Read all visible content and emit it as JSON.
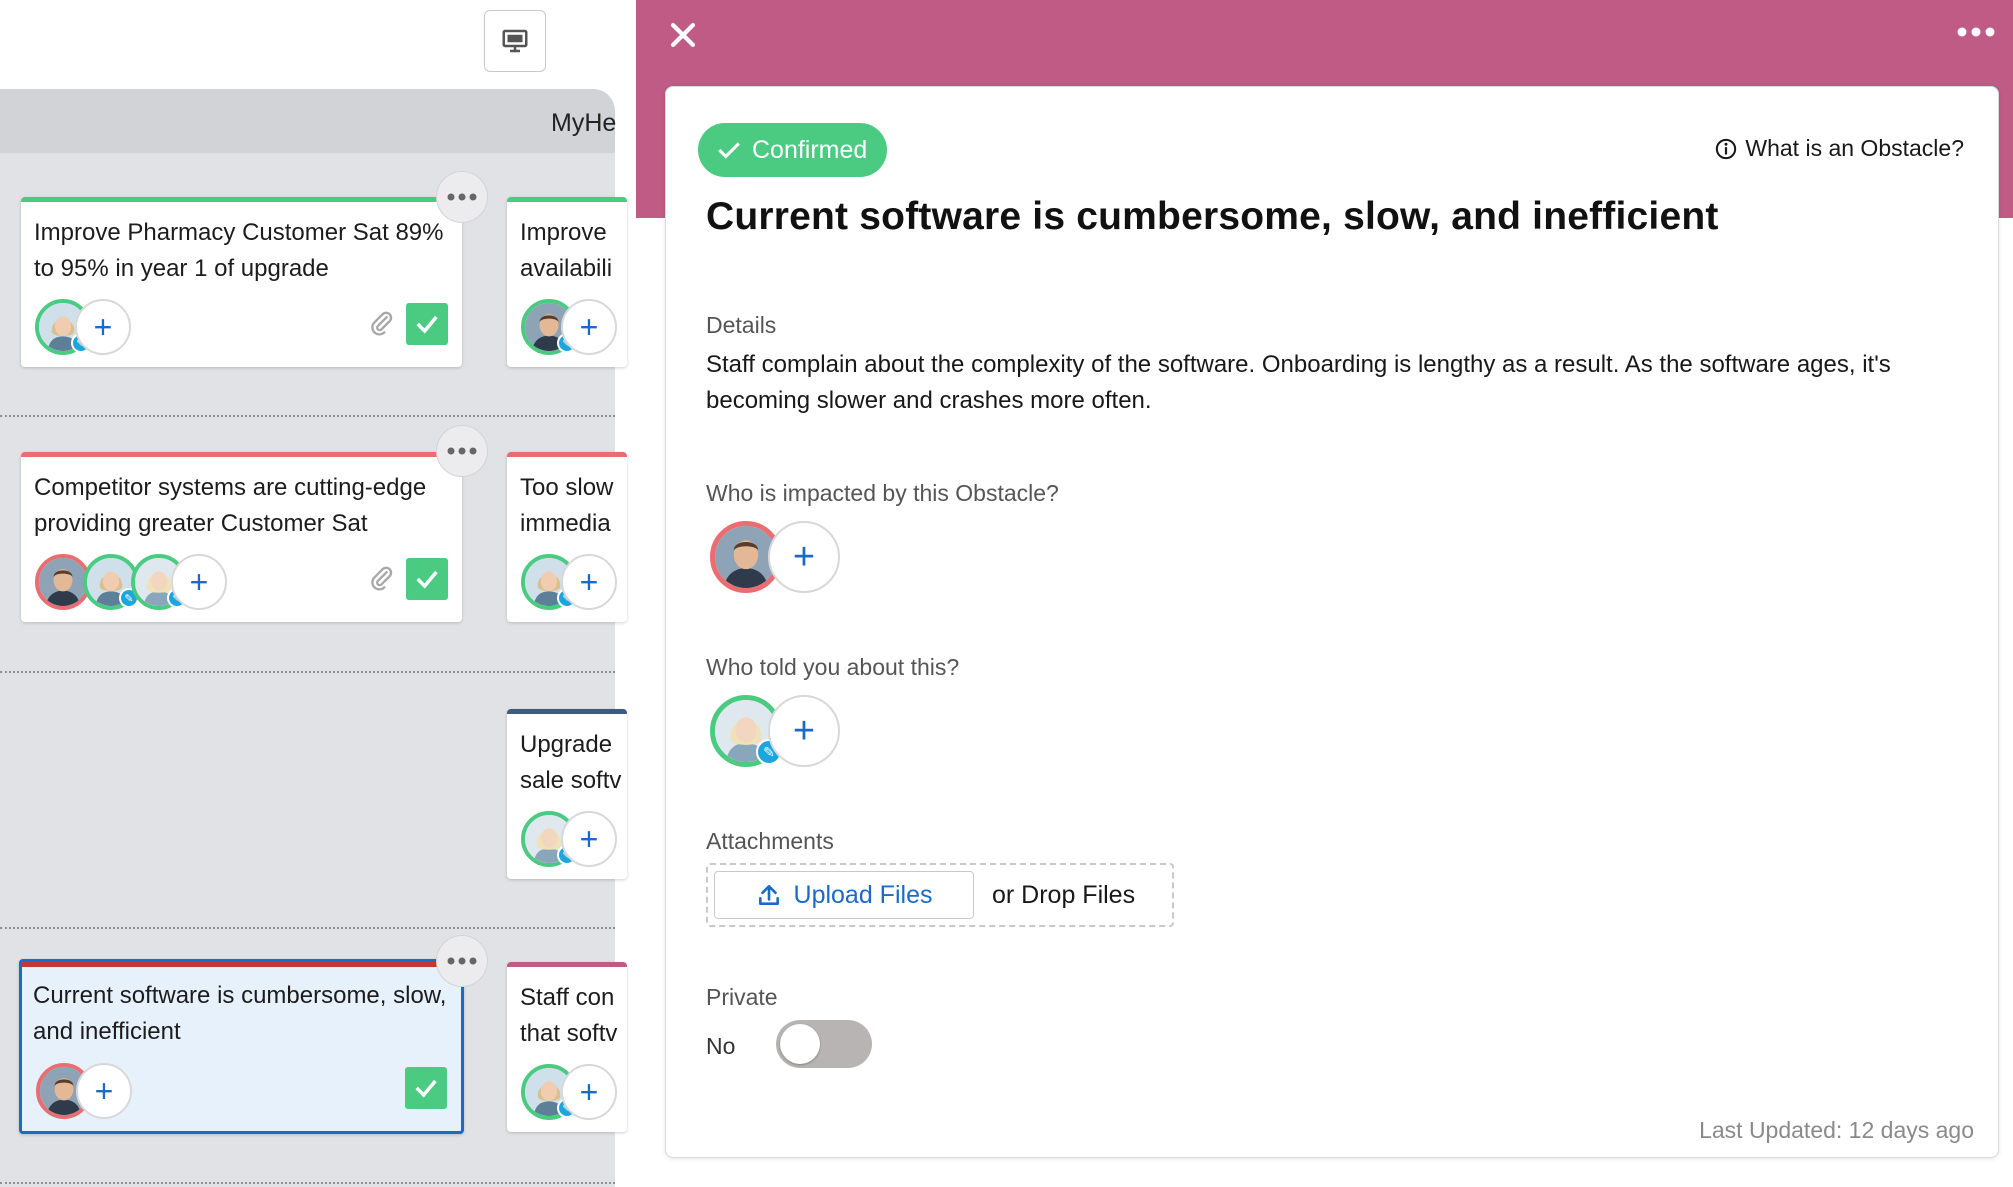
{
  "board": {
    "header_label": "MyHe",
    "cards": [
      {
        "title": "Improve Pharmacy Customer Sat 89% to 95% in year 1 of upgrade",
        "strip_color": "#4bca81"
      },
      {
        "title": "Improve availabili",
        "strip_color": "#4bca81"
      },
      {
        "title": "Competitor systems are cutting-edge providing greater Customer Sat",
        "strip_color": "#ea6d71"
      },
      {
        "title": "Too slow immedia",
        "strip_color": "#ea6d71"
      },
      {
        "title": "Upgrade sale softv",
        "strip_color": "#3e5a7c"
      },
      {
        "title": "Current software is cumbersome, slow, and inefficient",
        "strip_color": "#c23934"
      },
      {
        "title": "Staff con that softv",
        "strip_color": "#bf5b85"
      }
    ]
  },
  "panel": {
    "status": "Confirmed",
    "help_link": "What is an Obstacle?",
    "title": "Current software is cumbersome, slow, and inefficient",
    "details_label": "Details",
    "details_text": "Staff complain about the complexity of the software. Onboarding is lengthy as a result. As the software ages, it's becoming slower and crashes more often.",
    "impacted_label": "Who is impacted by this Obstacle?",
    "told_label": "Who told you about this?",
    "attachments_label": "Attachments",
    "upload_label": "Upload Files",
    "drop_label": "or Drop Files",
    "private_label": "Private",
    "private_value": "No",
    "last_updated": "Last Updated: 12 days ago"
  },
  "icons": {
    "close": "close-icon",
    "more": "more-horizontal-icon",
    "present": "presentation-icon",
    "check": "check-icon",
    "info": "info-icon",
    "upload": "upload-icon",
    "attachment": "paperclip-icon",
    "add": "plus-icon"
  },
  "colors": {
    "panel_accent": "#bf5b85",
    "confirmed": "#4bca81",
    "link_blue": "#1b6ac7",
    "selected_border": "#1b6ac7"
  }
}
